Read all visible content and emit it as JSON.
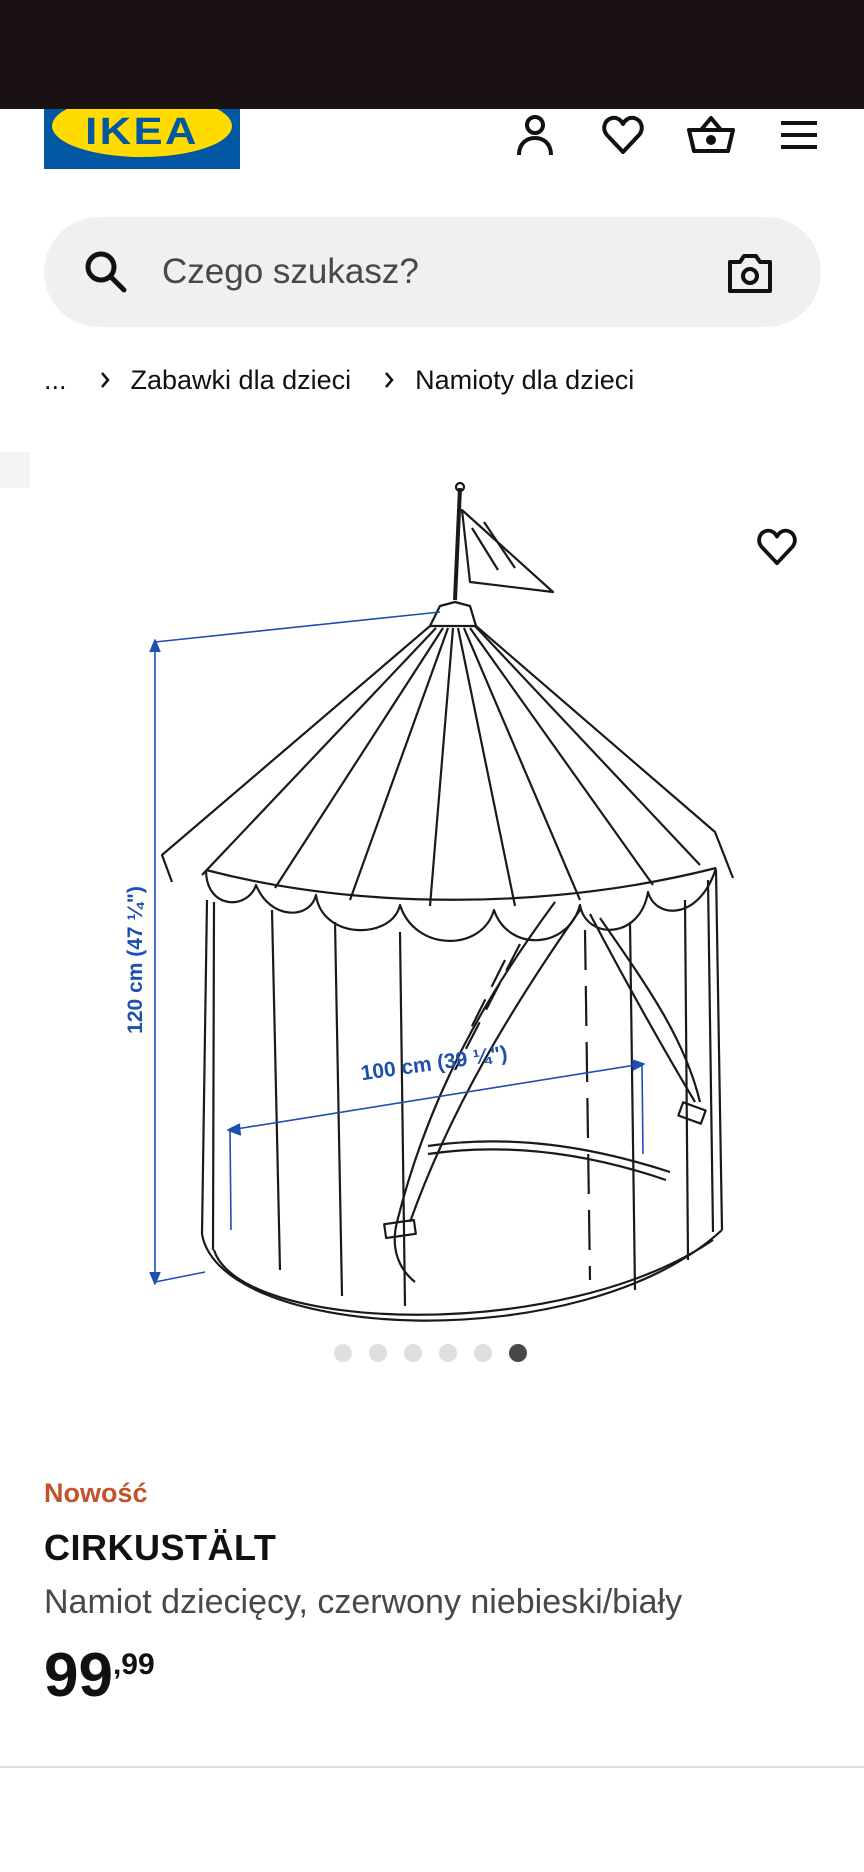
{
  "header": {
    "logo_text": "IKEA",
    "icons": [
      "user-icon",
      "heart-icon",
      "basket-icon",
      "menu-icon"
    ]
  },
  "search": {
    "placeholder": "Czego szukasz?",
    "icon": "search-icon",
    "camera_icon": "camera-icon"
  },
  "breadcrumb": {
    "ellipsis": "...",
    "items": [
      "Zabawki dla dzieci",
      "Namioty dla dzieci"
    ]
  },
  "gallery": {
    "dimension_height": "120 cm (47 ¼\")",
    "dimension_width": "100 cm (39 ¼\")",
    "image_count": 6,
    "active_index": 5
  },
  "product": {
    "badge": "Nowość",
    "name": "CIRKUSTÄLT",
    "description": "Namiot dziecięcy, czerwony niebieski/biały",
    "price_integer": "99",
    "price_decimal": ",99"
  },
  "colors": {
    "brand_blue": "#0058a3",
    "brand_yellow": "#ffdb00",
    "badge_orange": "#c4522a",
    "dimension_blue": "#1f4fb0"
  }
}
